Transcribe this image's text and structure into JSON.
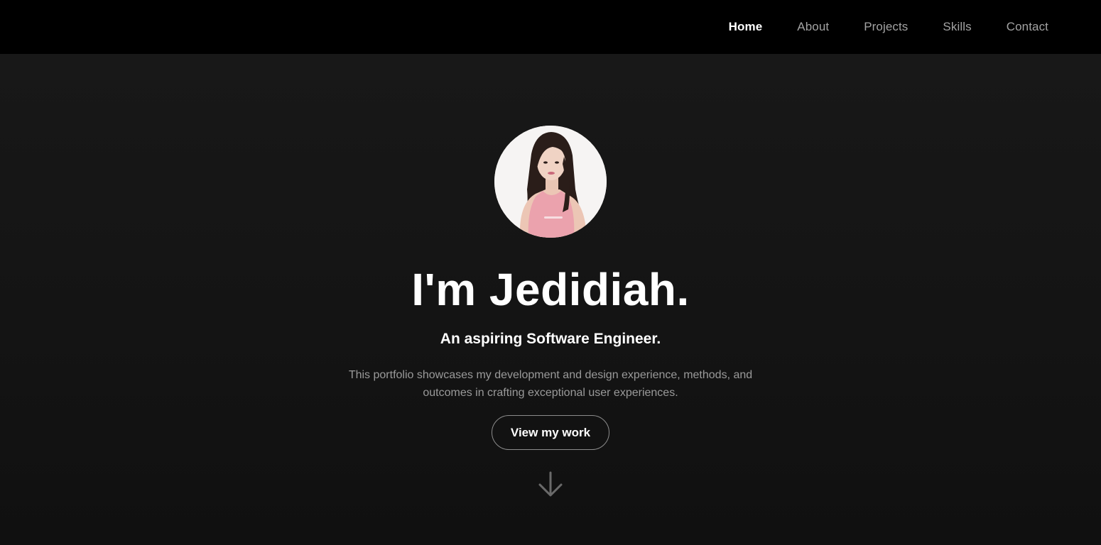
{
  "nav": {
    "items": [
      {
        "label": "Home",
        "active": true
      },
      {
        "label": "About",
        "active": false
      },
      {
        "label": "Projects",
        "active": false
      },
      {
        "label": "Skills",
        "active": false
      },
      {
        "label": "Contact",
        "active": false
      }
    ]
  },
  "hero": {
    "avatar_icon": "profile-photo",
    "title": "I'm Jedidiah.",
    "subtitle": "An aspiring Software Engineer.",
    "description_line1": "This portfolio showcases my development and design experience, methods, and",
    "description_line2": "outcomes in crafting exceptional user experiences.",
    "cta_label": "View my work",
    "scroll_icon": "arrow-down-icon"
  },
  "colors": {
    "nav_bg": "#000000",
    "page_bg": "#151515",
    "text_primary": "#ffffff",
    "text_muted": "#a3a3a3"
  }
}
